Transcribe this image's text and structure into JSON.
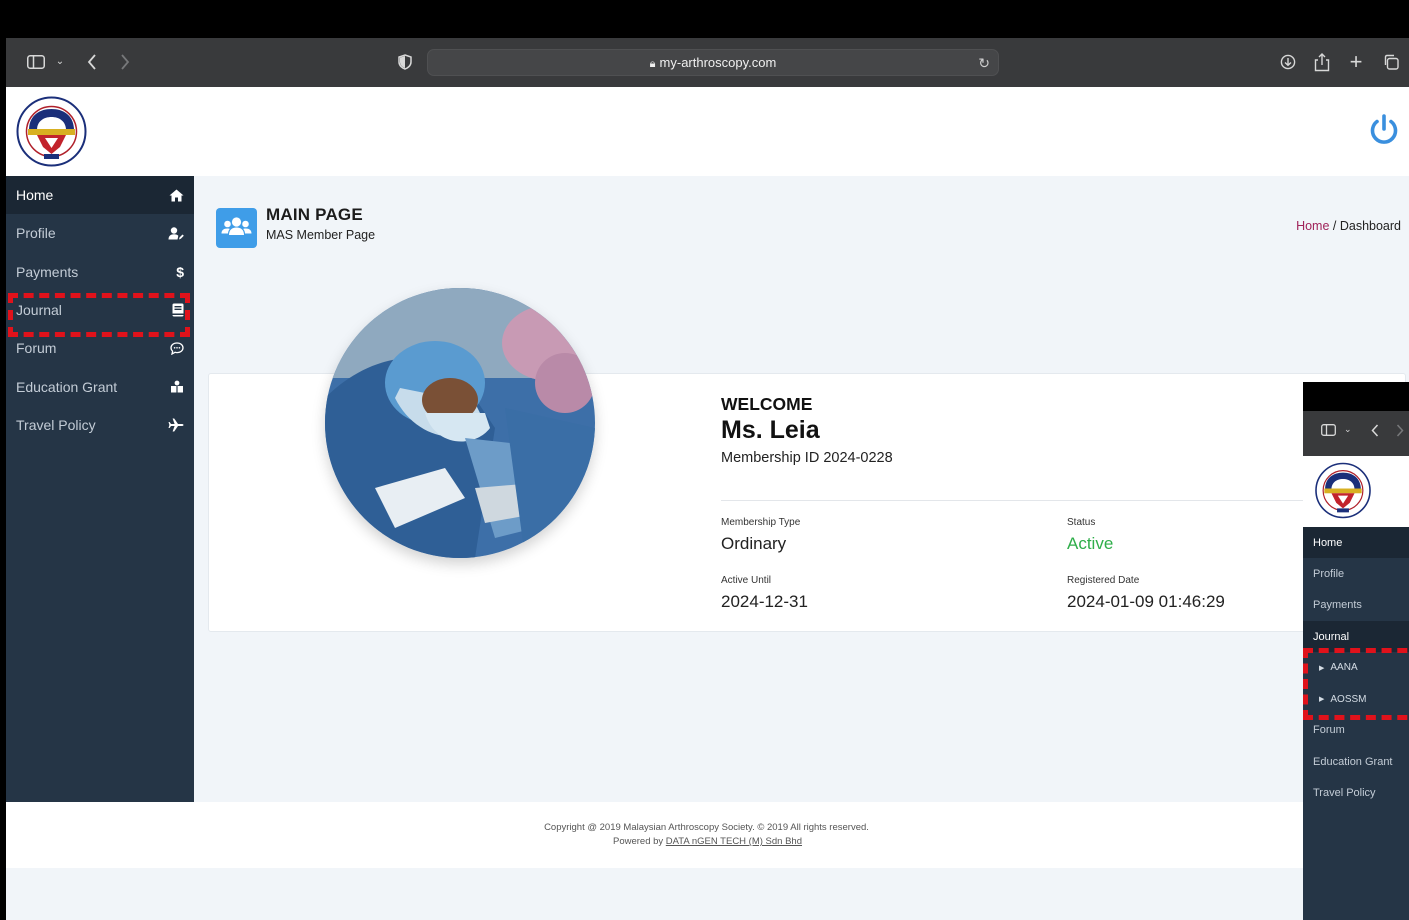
{
  "browser": {
    "url": "my-arthroscopy.com"
  },
  "sidebar": {
    "items": [
      {
        "label": "Home"
      },
      {
        "label": "Profile"
      },
      {
        "label": "Payments",
        "icon_glyph": "$"
      },
      {
        "label": "Journal"
      },
      {
        "label": "Forum"
      },
      {
        "label": "Education Grant"
      },
      {
        "label": "Travel Policy"
      }
    ]
  },
  "header": {
    "title": "MAIN PAGE",
    "subtitle": "MAS Member Page",
    "breadcrumb_home": "Home",
    "breadcrumb_separator": " / ",
    "breadcrumb_current": "Dashboard"
  },
  "welcome": {
    "heading": "WELCOME",
    "name": "Ms. Leia",
    "membership_id": "Membership ID 2024-0228"
  },
  "details": {
    "membership_type_label": "Membership Type",
    "membership_type": "Ordinary",
    "status_label": "Status",
    "status": "Active",
    "active_until_label": "Active Until",
    "active_until": "2024-12-31",
    "registered_label": "Registered Date",
    "registered": "2024-01-09 01:46:29"
  },
  "footer": {
    "copyright": "Copyright @ 2019 Malaysian Arthroscopy Society. © 2019 All rights reserved.",
    "powered_prefix": "Powered by ",
    "powered_link": "DATA nGEN TECH (M) Sdn Bhd"
  },
  "second_window": {
    "sidebar": [
      {
        "label": "Home"
      },
      {
        "label": "Profile"
      },
      {
        "label": "Payments"
      },
      {
        "label": "Journal"
      },
      {
        "label": "AANA"
      },
      {
        "label": "AOSSM"
      },
      {
        "label": "Forum"
      },
      {
        "label": "Education Grant"
      },
      {
        "label": "Travel Policy"
      }
    ]
  },
  "colors": {
    "sidebar_bg": "#253546",
    "sidebar_active": "#1b2734",
    "accent_blue": "#3f9de8",
    "status_green": "#2fae4a",
    "highlight_red": "#e0121b"
  }
}
